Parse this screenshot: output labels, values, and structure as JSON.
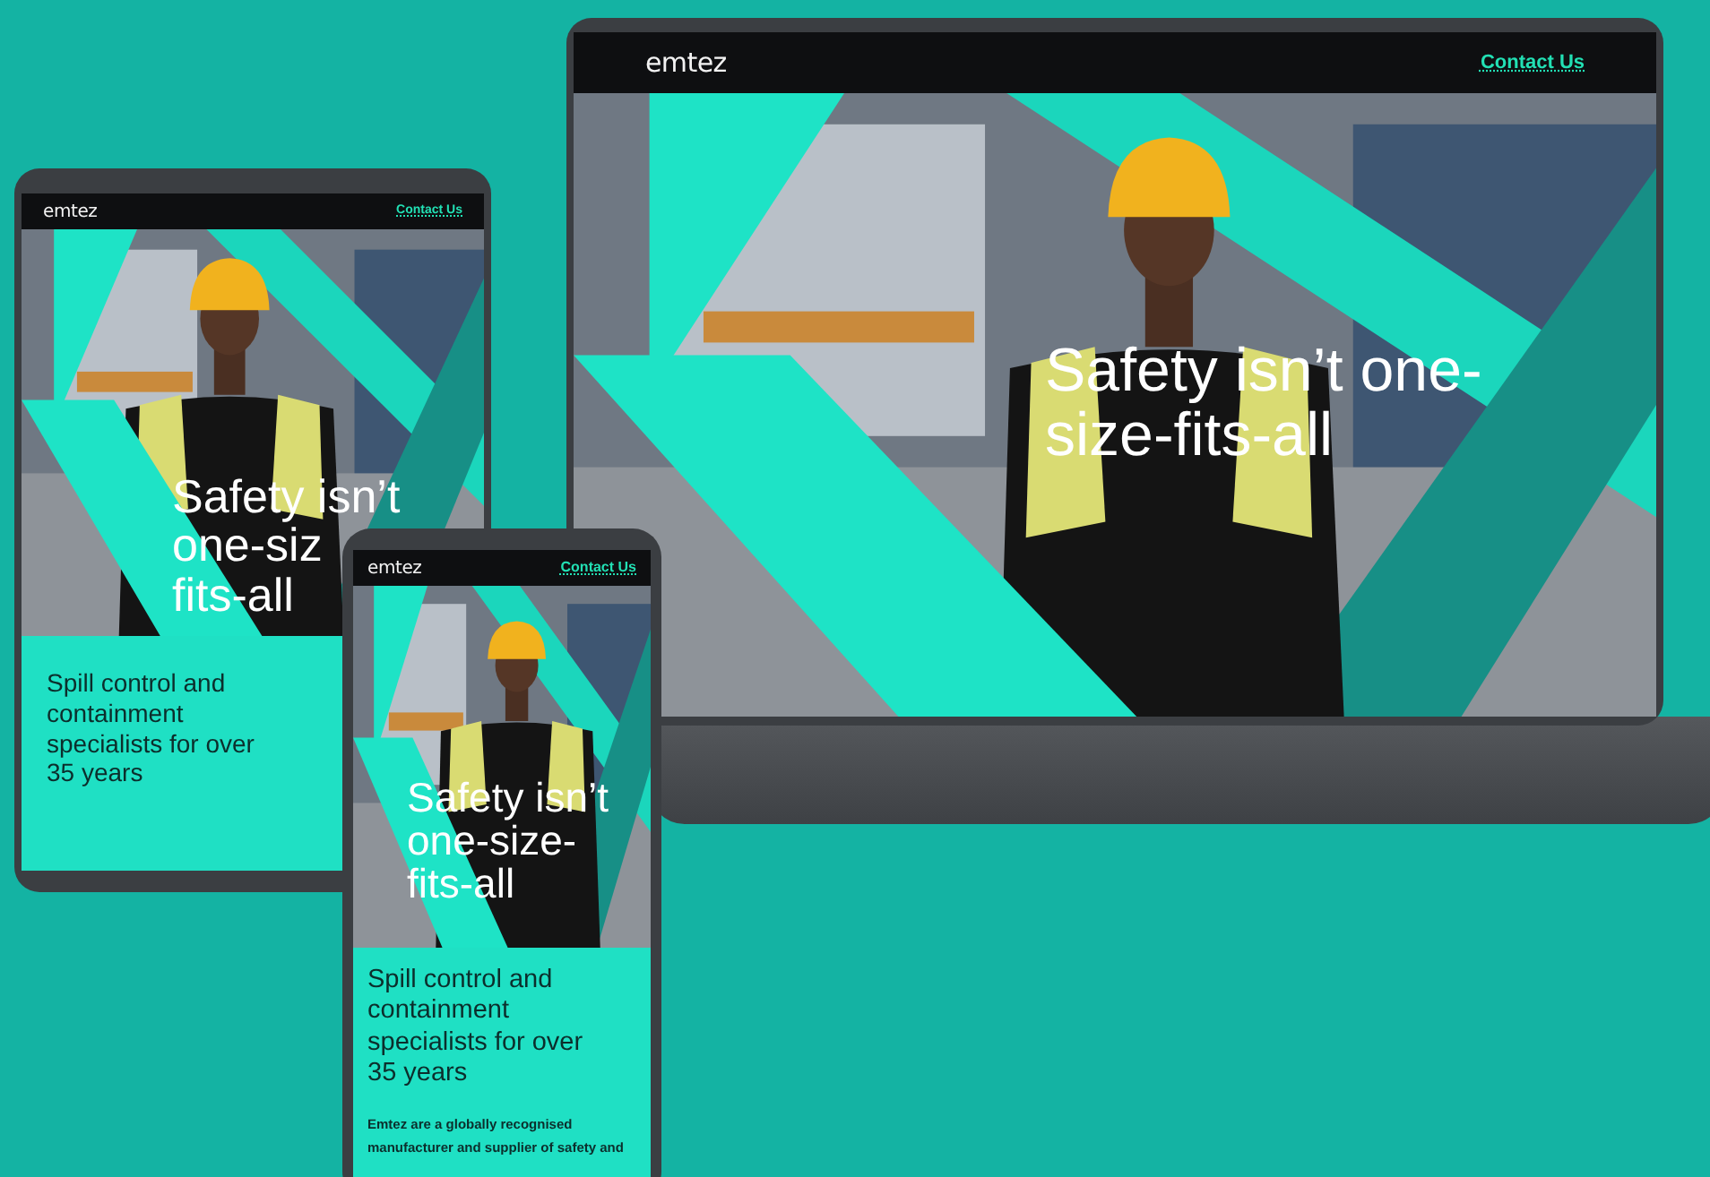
{
  "devices": [
    {
      "kind": "laptop",
      "logo": "emtez",
      "nav_link": "Contact Us",
      "hero": {
        "kind": "picture"
      },
      "headline": [
        "Safety isn’t one-",
        "size-fits-all"
      ]
    },
    {
      "kind": "tablet",
      "logo": "emtez",
      "nav_link": "Contact Us",
      "hero": {
        "kind": "picture"
      },
      "headline": [
        "Safety isn’t",
        "one-siz",
        "fits-all"
      ],
      "intro": "Spill control and containment specialists for over 35 years"
    },
    {
      "kind": "phone",
      "logo": "emtez",
      "nav_link": "Contact Us",
      "hero": {
        "kind": "picture"
      },
      "headline": [
        "Safety isn’t",
        "one-size-",
        "fits-all"
      ],
      "intro": "Spill control and containment specialists for over 35 years",
      "body": "Emtez are a globally recognised manufacturer and supplier of safety and"
    }
  ]
}
